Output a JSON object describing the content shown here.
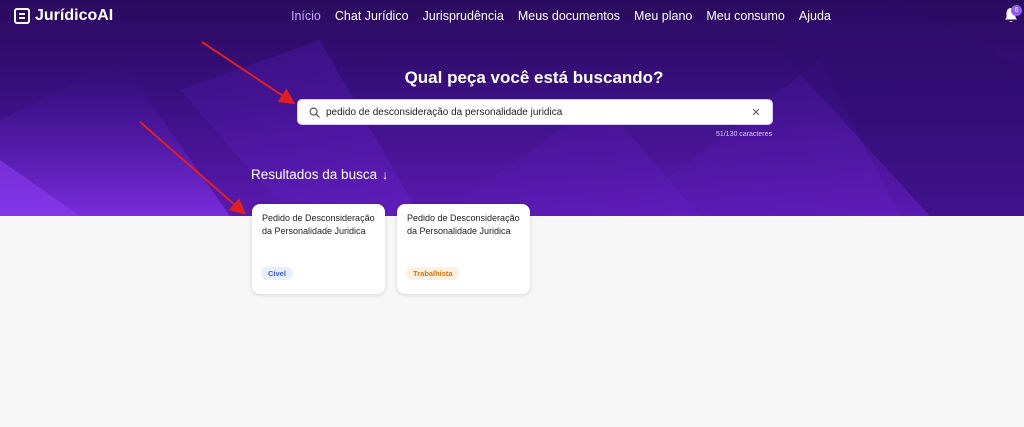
{
  "app": {
    "logo_text": "JurídicoAI"
  },
  "nav": {
    "items": [
      {
        "label": "Início",
        "active": true
      },
      {
        "label": "Chat Jurídico",
        "active": false
      },
      {
        "label": "Jurisprudência",
        "active": false
      },
      {
        "label": "Meus documentos",
        "active": false
      },
      {
        "label": "Meu plano",
        "active": false
      },
      {
        "label": "Meu consumo",
        "active": false
      },
      {
        "label": "Ajuda",
        "active": false
      }
    ]
  },
  "notifications": {
    "count": "6"
  },
  "hero": {
    "headline": "Qual peça você está buscando?",
    "search_value": "pedido de desconsideração da personalidade juridica",
    "counter": "51/130 caracteres"
  },
  "results": {
    "title": "Resultados da busca",
    "cards": [
      {
        "title": "Pedido de Desconsideração da Personalidade Juridica",
        "tag": "Cível"
      },
      {
        "title": "Pedido de Desconsideração da Personalidade Juridica",
        "tag": "Trabalhista"
      }
    ]
  },
  "colors": {
    "hero_top": "#2a0a5e",
    "hero_bottom": "#5a1ab0",
    "nav_active": "#c9a6ff",
    "annotation_arrow": "#e02020",
    "tag_civel": "#3b5bdb",
    "tag_trabalhista": "#d97706"
  },
  "icons": {
    "logo": "document-icon",
    "notifications": "bell-icon",
    "search": "search-icon",
    "clear": "close-icon",
    "results_arrow": "arrow-down-icon"
  }
}
